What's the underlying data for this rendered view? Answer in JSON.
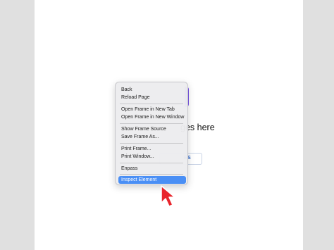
{
  "page": {
    "bg_heading_fragment": "ges here",
    "bg_button_fragment": "ES"
  },
  "context_menu": {
    "items": [
      {
        "label": "Back"
      },
      {
        "label": "Reload Page"
      },
      {
        "label": "Open Frame in New Tab"
      },
      {
        "label": "Open Frame in New Window"
      },
      {
        "label": "Show Frame Source"
      },
      {
        "label": "Save Frame As..."
      },
      {
        "label": "Print Frame..."
      },
      {
        "label": "Print Window..."
      },
      {
        "label": "Enpass"
      },
      {
        "label": "Inspect Element"
      }
    ],
    "highlighted": "Inspect Element"
  },
  "colors": {
    "highlight": "#4a8ff5",
    "accent": "#7b57e8",
    "cursor": "#e8242b"
  },
  "icons": [
    "red-arrow-cursor-icon"
  ]
}
